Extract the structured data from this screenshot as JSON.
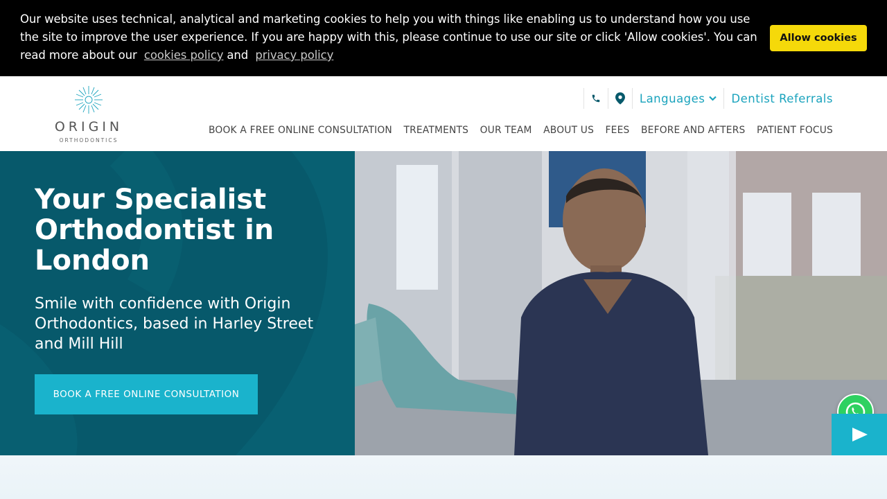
{
  "cookie_bar": {
    "text_before": "Our website uses technical, analytical and marketing cookies to help you with things like enabling us to understand how you use the site to improve the user experience. If you are happy with this, please continue to use our site or click 'Allow cookies'. You can read more about our",
    "cookies_policy_link": "cookies policy",
    "and_text": "and",
    "privacy_policy_link": "privacy policy",
    "allow_button": "Allow cookies"
  },
  "logo": {
    "word": "ORIGIN",
    "sub": "ORTHODONTICS"
  },
  "util": {
    "phone_icon": "phone-icon",
    "location_icon": "map-pin-icon",
    "languages": "Languages",
    "referrals": "Dentist Referrals"
  },
  "nav": [
    "BOOK A FREE ONLINE CONSULTATION",
    "TREATMENTS",
    "OUR TEAM",
    "ABOUT US",
    "FEES",
    "BEFORE AND AFTERS",
    "PATIENT FOCUS"
  ],
  "hero": {
    "title": "Your Specialist Orthodontist in London",
    "subtitle": "Smile with confidence with Origin Orthodontics, based in Harley Street and Mill Hill",
    "cta": "BOOK A FREE ONLINE CONSULTATION"
  },
  "colors": {
    "cookie_bg": "#000000",
    "cookie_button": "#f5d90a",
    "brand_teal": "#1aa3bd",
    "hero_bg": "#07596b",
    "cta": "#1ab3cc",
    "whatsapp": "#2ed161"
  }
}
